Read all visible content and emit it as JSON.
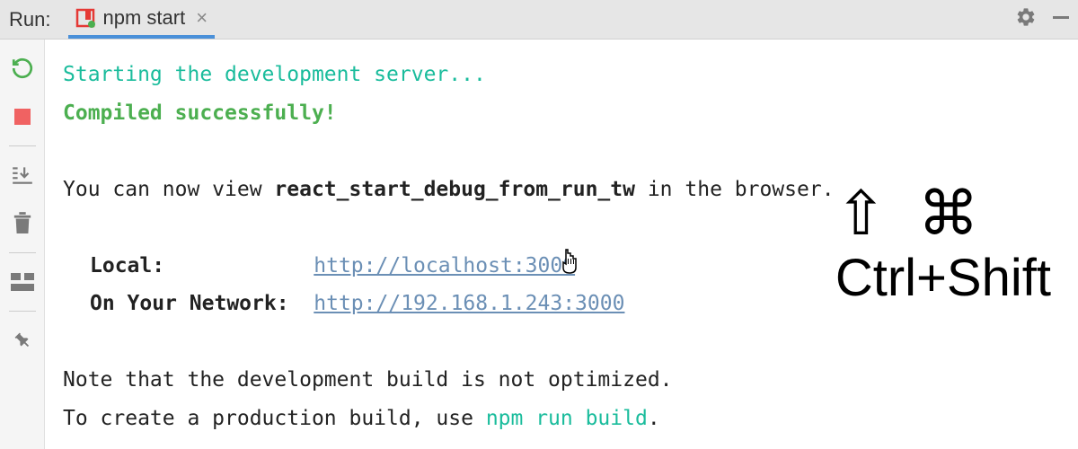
{
  "header": {
    "run_label": "Run:",
    "tab_label": "npm start",
    "tab_close": "×"
  },
  "console": {
    "line1": "Starting the development server...",
    "line2": "Compiled successfully!",
    "line3_pre": "You can now view ",
    "line3_bold": "react_start_debug_from_run_tw",
    "line3_post": " in the browser.",
    "local_label": "Local:",
    "local_url": "http://localhost:3000",
    "network_label": "On Your Network:",
    "network_url": "http://192.168.1.243:3000",
    "note1": "Note that the development build is not optimized.",
    "note2_pre": "To create a production build, use ",
    "note2_cmd": "npm run build",
    "note2_post": "."
  },
  "overlay": {
    "symbols": "⇧ ⌘",
    "text": "Ctrl+Shift"
  }
}
